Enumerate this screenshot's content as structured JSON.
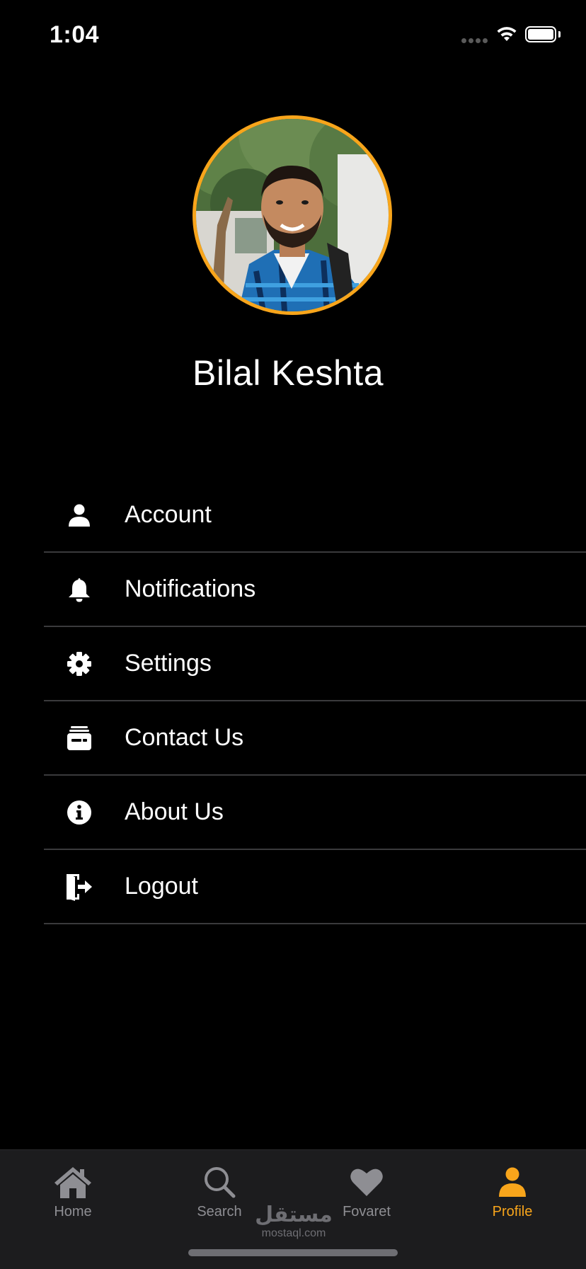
{
  "status_bar": {
    "time": "1:04"
  },
  "profile": {
    "name": "Bilal Keshta",
    "ring_color": "#f8a51b"
  },
  "menu": {
    "items": [
      {
        "label": "Account",
        "icon": "person-icon"
      },
      {
        "label": "Notifications",
        "icon": "bell-icon"
      },
      {
        "label": "Settings",
        "icon": "gear-icon"
      },
      {
        "label": "Contact Us",
        "icon": "wallet-icon"
      },
      {
        "label": "About Us",
        "icon": "info-icon"
      },
      {
        "label": "Logout",
        "icon": "logout-icon"
      }
    ]
  },
  "tab_bar": {
    "tabs": [
      {
        "label": "Home",
        "icon": "home-icon",
        "active": false
      },
      {
        "label": "Search",
        "icon": "search-icon",
        "active": false
      },
      {
        "label": "Fovaret",
        "icon": "heart-icon",
        "active": false
      },
      {
        "label": "Profile",
        "icon": "person-icon",
        "active": true
      }
    ],
    "active_color": "#f8a51b",
    "inactive_color": "#8e8e93"
  },
  "watermark": {
    "arabic": "مستقل",
    "latin": "mostaql.com"
  }
}
